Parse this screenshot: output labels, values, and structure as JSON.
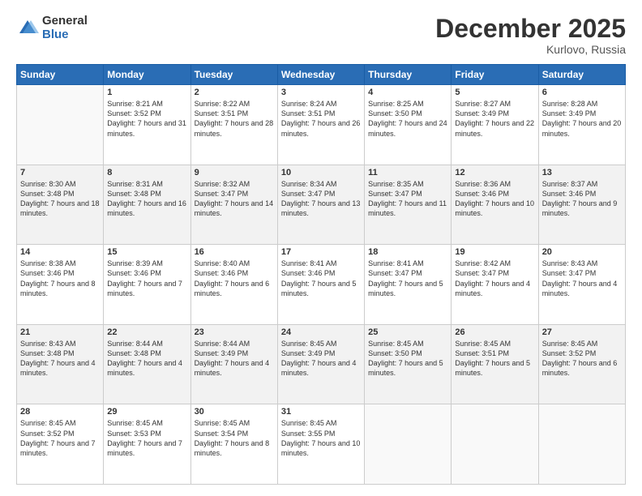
{
  "logo": {
    "general": "General",
    "blue": "Blue"
  },
  "title": "December 2025",
  "location": "Kurlovo, Russia",
  "days": [
    "Sunday",
    "Monday",
    "Tuesday",
    "Wednesday",
    "Thursday",
    "Friday",
    "Saturday"
  ],
  "weeks": [
    [
      {
        "day": "",
        "sunrise": "",
        "sunset": "",
        "daylight": "",
        "empty": true
      },
      {
        "day": "1",
        "sunrise": "Sunrise: 8:21 AM",
        "sunset": "Sunset: 3:52 PM",
        "daylight": "Daylight: 7 hours and 31 minutes."
      },
      {
        "day": "2",
        "sunrise": "Sunrise: 8:22 AM",
        "sunset": "Sunset: 3:51 PM",
        "daylight": "Daylight: 7 hours and 28 minutes."
      },
      {
        "day": "3",
        "sunrise": "Sunrise: 8:24 AM",
        "sunset": "Sunset: 3:51 PM",
        "daylight": "Daylight: 7 hours and 26 minutes."
      },
      {
        "day": "4",
        "sunrise": "Sunrise: 8:25 AM",
        "sunset": "Sunset: 3:50 PM",
        "daylight": "Daylight: 7 hours and 24 minutes."
      },
      {
        "day": "5",
        "sunrise": "Sunrise: 8:27 AM",
        "sunset": "Sunset: 3:49 PM",
        "daylight": "Daylight: 7 hours and 22 minutes."
      },
      {
        "day": "6",
        "sunrise": "Sunrise: 8:28 AM",
        "sunset": "Sunset: 3:49 PM",
        "daylight": "Daylight: 7 hours and 20 minutes."
      }
    ],
    [
      {
        "day": "7",
        "sunrise": "Sunrise: 8:30 AM",
        "sunset": "Sunset: 3:48 PM",
        "daylight": "Daylight: 7 hours and 18 minutes."
      },
      {
        "day": "8",
        "sunrise": "Sunrise: 8:31 AM",
        "sunset": "Sunset: 3:48 PM",
        "daylight": "Daylight: 7 hours and 16 minutes."
      },
      {
        "day": "9",
        "sunrise": "Sunrise: 8:32 AM",
        "sunset": "Sunset: 3:47 PM",
        "daylight": "Daylight: 7 hours and 14 minutes."
      },
      {
        "day": "10",
        "sunrise": "Sunrise: 8:34 AM",
        "sunset": "Sunset: 3:47 PM",
        "daylight": "Daylight: 7 hours and 13 minutes."
      },
      {
        "day": "11",
        "sunrise": "Sunrise: 8:35 AM",
        "sunset": "Sunset: 3:47 PM",
        "daylight": "Daylight: 7 hours and 11 minutes."
      },
      {
        "day": "12",
        "sunrise": "Sunrise: 8:36 AM",
        "sunset": "Sunset: 3:46 PM",
        "daylight": "Daylight: 7 hours and 10 minutes."
      },
      {
        "day": "13",
        "sunrise": "Sunrise: 8:37 AM",
        "sunset": "Sunset: 3:46 PM",
        "daylight": "Daylight: 7 hours and 9 minutes."
      }
    ],
    [
      {
        "day": "14",
        "sunrise": "Sunrise: 8:38 AM",
        "sunset": "Sunset: 3:46 PM",
        "daylight": "Daylight: 7 hours and 8 minutes."
      },
      {
        "day": "15",
        "sunrise": "Sunrise: 8:39 AM",
        "sunset": "Sunset: 3:46 PM",
        "daylight": "Daylight: 7 hours and 7 minutes."
      },
      {
        "day": "16",
        "sunrise": "Sunrise: 8:40 AM",
        "sunset": "Sunset: 3:46 PM",
        "daylight": "Daylight: 7 hours and 6 minutes."
      },
      {
        "day": "17",
        "sunrise": "Sunrise: 8:41 AM",
        "sunset": "Sunset: 3:46 PM",
        "daylight": "Daylight: 7 hours and 5 minutes."
      },
      {
        "day": "18",
        "sunrise": "Sunrise: 8:41 AM",
        "sunset": "Sunset: 3:47 PM",
        "daylight": "Daylight: 7 hours and 5 minutes."
      },
      {
        "day": "19",
        "sunrise": "Sunrise: 8:42 AM",
        "sunset": "Sunset: 3:47 PM",
        "daylight": "Daylight: 7 hours and 4 minutes."
      },
      {
        "day": "20",
        "sunrise": "Sunrise: 8:43 AM",
        "sunset": "Sunset: 3:47 PM",
        "daylight": "Daylight: 7 hours and 4 minutes."
      }
    ],
    [
      {
        "day": "21",
        "sunrise": "Sunrise: 8:43 AM",
        "sunset": "Sunset: 3:48 PM",
        "daylight": "Daylight: 7 hours and 4 minutes."
      },
      {
        "day": "22",
        "sunrise": "Sunrise: 8:44 AM",
        "sunset": "Sunset: 3:48 PM",
        "daylight": "Daylight: 7 hours and 4 minutes."
      },
      {
        "day": "23",
        "sunrise": "Sunrise: 8:44 AM",
        "sunset": "Sunset: 3:49 PM",
        "daylight": "Daylight: 7 hours and 4 minutes."
      },
      {
        "day": "24",
        "sunrise": "Sunrise: 8:45 AM",
        "sunset": "Sunset: 3:49 PM",
        "daylight": "Daylight: 7 hours and 4 minutes."
      },
      {
        "day": "25",
        "sunrise": "Sunrise: 8:45 AM",
        "sunset": "Sunset: 3:50 PM",
        "daylight": "Daylight: 7 hours and 5 minutes."
      },
      {
        "day": "26",
        "sunrise": "Sunrise: 8:45 AM",
        "sunset": "Sunset: 3:51 PM",
        "daylight": "Daylight: 7 hours and 5 minutes."
      },
      {
        "day": "27",
        "sunrise": "Sunrise: 8:45 AM",
        "sunset": "Sunset: 3:52 PM",
        "daylight": "Daylight: 7 hours and 6 minutes."
      }
    ],
    [
      {
        "day": "28",
        "sunrise": "Sunrise: 8:45 AM",
        "sunset": "Sunset: 3:52 PM",
        "daylight": "Daylight: 7 hours and 7 minutes."
      },
      {
        "day": "29",
        "sunrise": "Sunrise: 8:45 AM",
        "sunset": "Sunset: 3:53 PM",
        "daylight": "Daylight: 7 hours and 7 minutes."
      },
      {
        "day": "30",
        "sunrise": "Sunrise: 8:45 AM",
        "sunset": "Sunset: 3:54 PM",
        "daylight": "Daylight: 7 hours and 8 minutes."
      },
      {
        "day": "31",
        "sunrise": "Sunrise: 8:45 AM",
        "sunset": "Sunset: 3:55 PM",
        "daylight": "Daylight: 7 hours and 10 minutes."
      },
      {
        "day": "",
        "sunrise": "",
        "sunset": "",
        "daylight": "",
        "empty": true
      },
      {
        "day": "",
        "sunrise": "",
        "sunset": "",
        "daylight": "",
        "empty": true
      },
      {
        "day": "",
        "sunrise": "",
        "sunset": "",
        "daylight": "",
        "empty": true
      }
    ]
  ]
}
